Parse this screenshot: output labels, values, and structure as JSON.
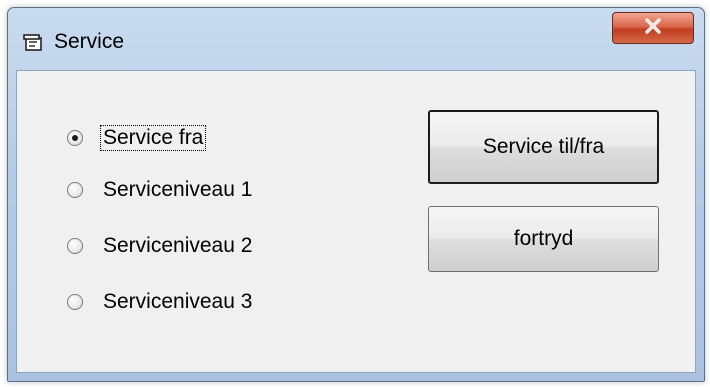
{
  "window": {
    "title": "Service"
  },
  "title_icon": "window-app-icon",
  "close_icon": "close-x-icon",
  "radio_options": [
    {
      "label": "Service fra",
      "checked": true
    },
    {
      "label": "Serviceniveau 1",
      "checked": false
    },
    {
      "label": "Serviceniveau 2",
      "checked": false
    },
    {
      "label": "Serviceniveau 3",
      "checked": false
    }
  ],
  "buttons": {
    "toggle_label": "Service til/fra",
    "cancel_label": "fortryd"
  },
  "colors": {
    "close_button": "#c94a2c",
    "title_bar": "#b7cde6",
    "client_bg": "#f0f0f0"
  }
}
